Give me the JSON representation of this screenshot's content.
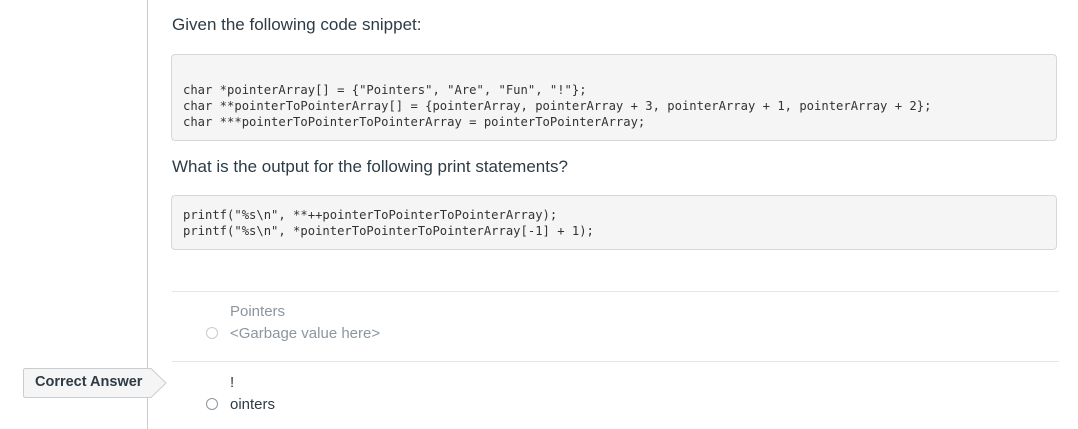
{
  "question": {
    "prompt": "Given the following code snippet:",
    "code_lines": [
      "char *pointerArray[] = {\"Pointers\", \"Are\", \"Fun\", \"!\"};",
      "char **pointerToPointerArray[] = {pointerArray, pointerArray + 3, pointerArray + 1, pointerArray + 2};",
      "char ***pointerToPointerToPointerArray = pointerToPointerArray;"
    ],
    "followup": "What is the output for the following print statements?",
    "print_lines": [
      "printf(\"%s\\n\", **++pointerToPointerToPointerArray);",
      "printf(\"%s\\n\", *pointerToPointerToPointerArray[-1] + 1);"
    ]
  },
  "answers": [
    {
      "line1": "Pointers",
      "line2": "<Garbage value here>",
      "correct": false
    },
    {
      "line1": "!",
      "line2": "ointers",
      "correct": true
    }
  ],
  "correct_answer_label": "Correct Answer",
  "colors": {
    "text": "#2d3b45",
    "muted_text": "#8b969e",
    "code_bg": "#f5f5f5",
    "code_border": "#d8d8d8",
    "divider": "#e4e6e8"
  }
}
